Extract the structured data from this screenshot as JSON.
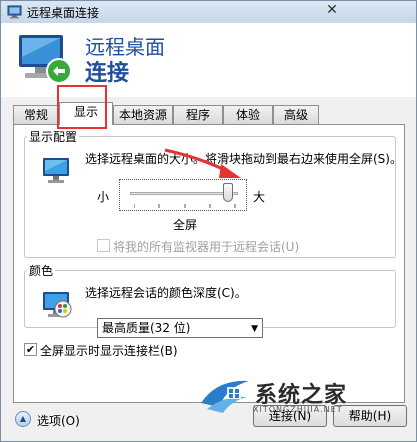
{
  "window": {
    "title": "远程桌面连接",
    "close_glyph": "✕"
  },
  "header": {
    "line1": "远程桌面",
    "line2": "连接"
  },
  "tabs": [
    {
      "label": "常规"
    },
    {
      "label": "显示",
      "active": true
    },
    {
      "label": "本地资源"
    },
    {
      "label": "程序"
    },
    {
      "label": "体验"
    },
    {
      "label": "高级"
    }
  ],
  "display_config": {
    "legend": "显示配置",
    "description": "选择远程桌面的大小。将滑块拖动到最右边来使用全屏(S)。",
    "slider_min_label": "小",
    "slider_max_label": "大",
    "slider_value_label": "全屏",
    "slider_level": 1.0,
    "all_monitors_label": "将我的所有监视器用于远程会话(U)",
    "all_monitors_checked": false,
    "all_monitors_enabled": false
  },
  "colors": {
    "legend": "颜色",
    "description": "选择远程会话的颜色深度(C)。",
    "selected_option": "最高质量(32 位)"
  },
  "fullscreen_bar": {
    "label": "全屏显示时显示连接栏(B)",
    "checked": true,
    "check_glyph": "✔"
  },
  "footer": {
    "options_label": "选项(O)",
    "connect_label": "连接(N)",
    "help_label": "帮助(H)"
  },
  "watermark": {
    "text": "系统之家",
    "url": "XITONGZHIJIA.NET"
  },
  "accent": {
    "title_blue": "#1f4f9e",
    "highlight_red": "#e53333"
  }
}
